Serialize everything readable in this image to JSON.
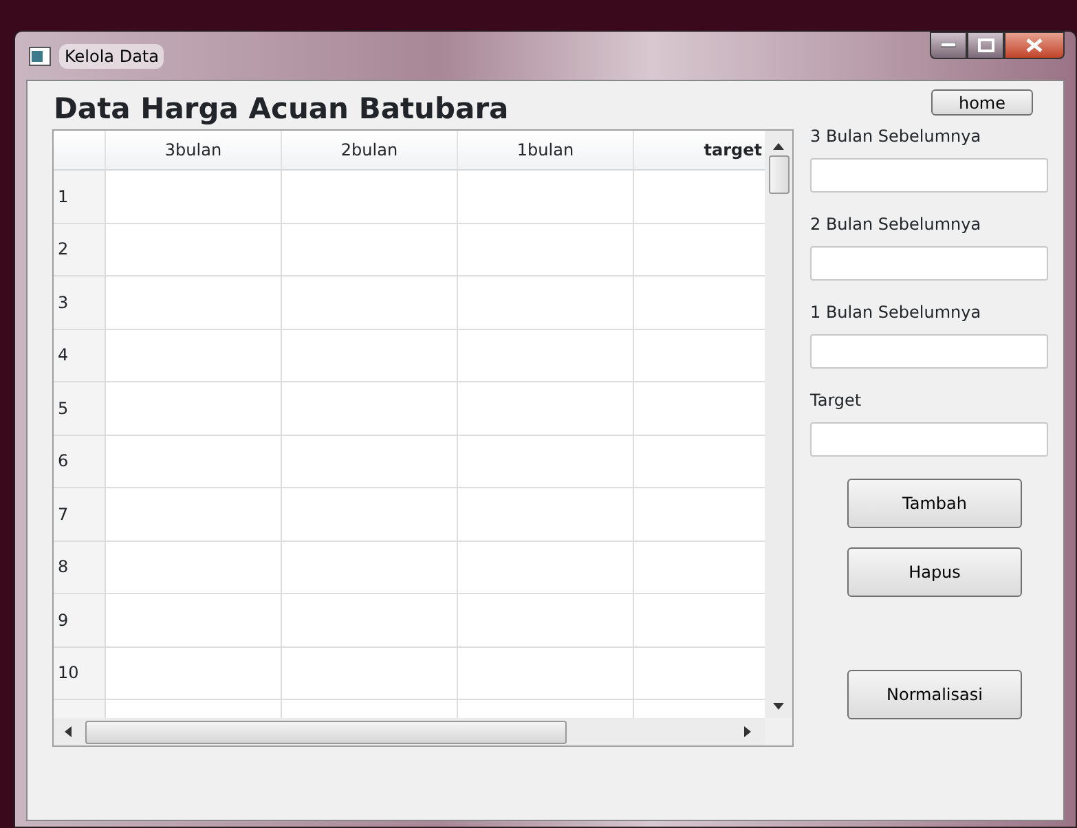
{
  "window": {
    "title": "Kelola Data"
  },
  "heading": "Data Harga Acuan Batubara",
  "home_button": "home",
  "table": {
    "columns": [
      {
        "label": "3bulan",
        "selected": false
      },
      {
        "label": "2bulan",
        "selected": false
      },
      {
        "label": "1bulan",
        "selected": false
      },
      {
        "label": "target",
        "selected": true
      }
    ],
    "rows": [
      "1",
      "2",
      "3",
      "4",
      "5",
      "6",
      "7",
      "8",
      "9",
      "10"
    ]
  },
  "form": {
    "fields": [
      {
        "label": "3 Bulan Sebelumnya"
      },
      {
        "label": "2 Bulan Sebelumnya"
      },
      {
        "label": "1 Bulan Sebelumnya"
      },
      {
        "label": "Target"
      }
    ]
  },
  "buttons": [
    "Tambah",
    "Hapus",
    "Normalisasi"
  ]
}
